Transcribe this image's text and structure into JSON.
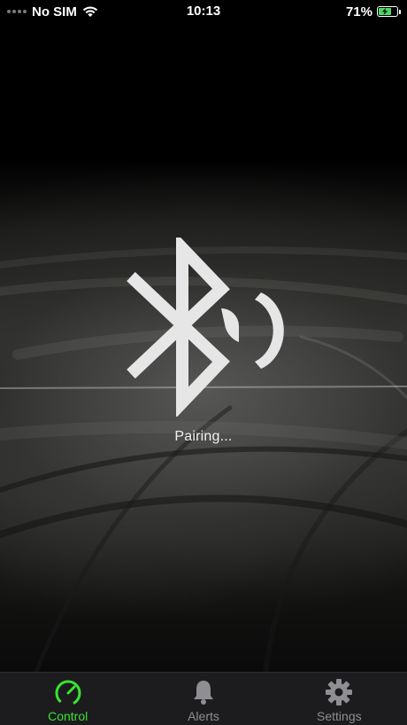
{
  "status_bar": {
    "carrier": "No SIM",
    "time": "10:13",
    "battery_percent": "71%",
    "battery_level": 0.71
  },
  "main": {
    "status_text": "Pairing...",
    "icon": "bluetooth-icon"
  },
  "tabs": [
    {
      "label": "Control",
      "icon": "speedometer-icon",
      "active": true
    },
    {
      "label": "Alerts",
      "icon": "bell-icon",
      "active": false
    },
    {
      "label": "Settings",
      "icon": "gear-icon",
      "active": false
    }
  ],
  "colors": {
    "accent": "#39e32f",
    "tab_inactive": "#8e8e93",
    "tab_bar_bg": "#1c1c1e",
    "icon_fill": "#e6e6e6",
    "battery_fill": "#4cd964"
  }
}
